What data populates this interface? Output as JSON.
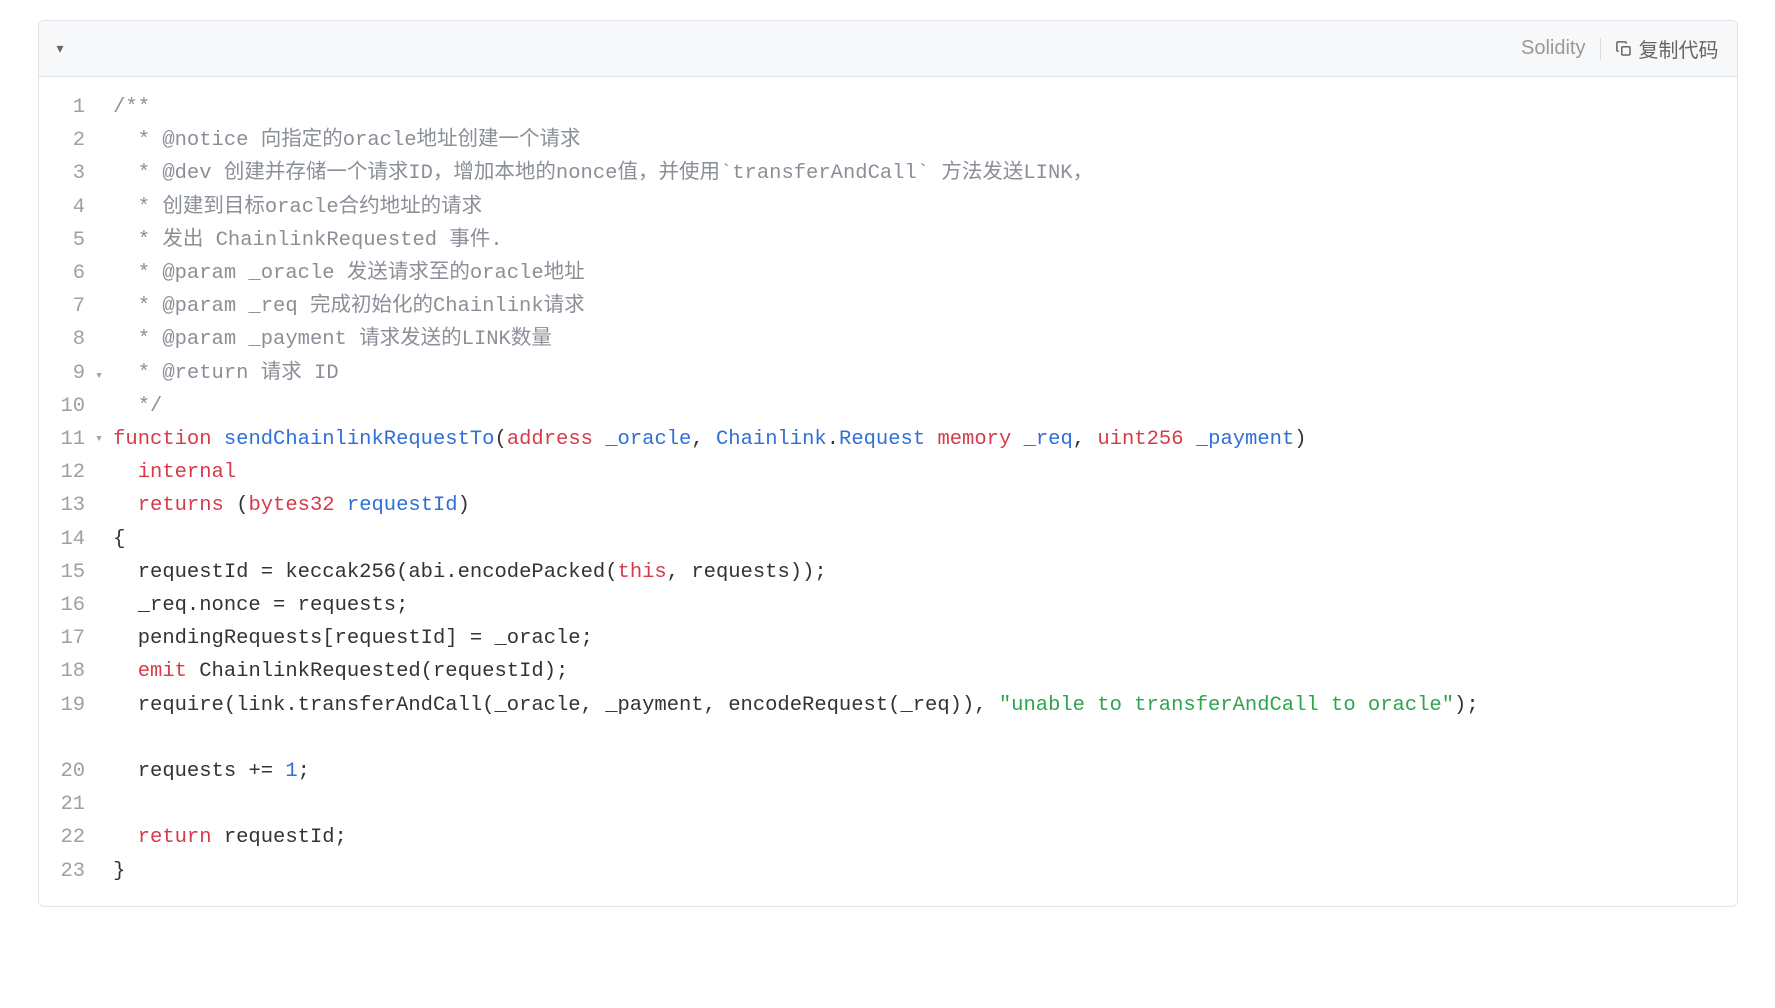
{
  "header": {
    "language": "Solidity",
    "copy_label": "复制代码"
  },
  "code": {
    "lines": [
      {
        "n": 1,
        "fold": "",
        "tokens": [
          {
            "t": "/**",
            "c": "tok-doc"
          }
        ]
      },
      {
        "n": 2,
        "fold": "",
        "tokens": [
          {
            "t": "  * @notice 向指定的oracle地址创建一个请求",
            "c": "tok-doc"
          }
        ]
      },
      {
        "n": 3,
        "fold": "",
        "tokens": [
          {
            "t": "  * @dev 创建并存储一个请求ID，增加本地的nonce值，并使用`transferAndCall` 方法发送LINK，",
            "c": "tok-doc"
          }
        ]
      },
      {
        "n": 4,
        "fold": "",
        "tokens": [
          {
            "t": "  * 创建到目标oracle合约地址的请求",
            "c": "tok-doc"
          }
        ]
      },
      {
        "n": 5,
        "fold": "",
        "tokens": [
          {
            "t": "  * 发出 ChainlinkRequested 事件.",
            "c": "tok-doc"
          }
        ]
      },
      {
        "n": 6,
        "fold": "",
        "tokens": [
          {
            "t": "  * @param _oracle 发送请求至的oracle地址",
            "c": "tok-doc"
          }
        ]
      },
      {
        "n": 7,
        "fold": "",
        "tokens": [
          {
            "t": "  * @param _req 完成初始化的Chainlink请求",
            "c": "tok-doc"
          }
        ]
      },
      {
        "n": 8,
        "fold": "",
        "tokens": [
          {
            "t": "  * @param _payment 请求发送的LINK数量",
            "c": "tok-doc"
          }
        ]
      },
      {
        "n": 9,
        "fold": "",
        "tokens": [
          {
            "t": "  * @return 请求 ID",
            "c": "tok-doc"
          }
        ]
      },
      {
        "n": 10,
        "fold": "",
        "tokens": [
          {
            "t": "  */",
            "c": "tok-doc"
          }
        ]
      },
      {
        "n": 11,
        "fold": "",
        "tokens": [
          {
            "t": "function",
            "c": "tok-kw"
          },
          {
            "t": " ",
            "c": ""
          },
          {
            "t": "sendChainlinkRequestTo",
            "c": "tok-fn"
          },
          {
            "t": "(",
            "c": "tok-punc"
          },
          {
            "t": "address",
            "c": "tok-type"
          },
          {
            "t": " ",
            "c": ""
          },
          {
            "t": "_oracle",
            "c": "tok-ident"
          },
          {
            "t": ", ",
            "c": "tok-punc"
          },
          {
            "t": "Chainlink",
            "c": "tok-ident"
          },
          {
            "t": ".",
            "c": "tok-punc"
          },
          {
            "t": "Request",
            "c": "tok-ident"
          },
          {
            "t": " ",
            "c": ""
          },
          {
            "t": "memory",
            "c": "tok-kw"
          },
          {
            "t": " ",
            "c": ""
          },
          {
            "t": "_req",
            "c": "tok-ident"
          },
          {
            "t": ", ",
            "c": "tok-punc"
          },
          {
            "t": "uint256",
            "c": "tok-type"
          },
          {
            "t": " ",
            "c": ""
          },
          {
            "t": "_payment",
            "c": "tok-ident"
          },
          {
            "t": ")",
            "c": "tok-punc"
          }
        ]
      },
      {
        "n": 12,
        "fold": "",
        "tokens": [
          {
            "t": "  ",
            "c": ""
          },
          {
            "t": "internal",
            "c": "tok-kw"
          }
        ]
      },
      {
        "n": 13,
        "fold": "",
        "tokens": [
          {
            "t": "  ",
            "c": ""
          },
          {
            "t": "returns",
            "c": "tok-kw"
          },
          {
            "t": " (",
            "c": "tok-punc"
          },
          {
            "t": "bytes32",
            "c": "tok-type"
          },
          {
            "t": " ",
            "c": ""
          },
          {
            "t": "requestId",
            "c": "tok-ident"
          },
          {
            "t": ")",
            "c": "tok-punc"
          }
        ]
      },
      {
        "n": 14,
        "fold": "▾",
        "tokens": [
          {
            "t": "{",
            "c": "tok-punc"
          }
        ]
      },
      {
        "n": 15,
        "fold": "",
        "tokens": [
          {
            "t": "  requestId ",
            "c": ""
          },
          {
            "t": "=",
            "c": "tok-op"
          },
          {
            "t": " keccak256(abi.encodePacked(",
            "c": ""
          },
          {
            "t": "this",
            "c": "tok-this"
          },
          {
            "t": ", requests));",
            "c": ""
          }
        ]
      },
      {
        "n": 16,
        "fold": "",
        "tokens": [
          {
            "t": "  _req.nonce ",
            "c": ""
          },
          {
            "t": "=",
            "c": "tok-op"
          },
          {
            "t": " requests;",
            "c": ""
          }
        ]
      },
      {
        "n": 17,
        "fold": "▾",
        "tokens": [
          {
            "t": "  pendingRequests[requestId] ",
            "c": ""
          },
          {
            "t": "=",
            "c": "tok-op"
          },
          {
            "t": " _oracle;",
            "c": ""
          }
        ]
      },
      {
        "n": 18,
        "fold": "",
        "tokens": [
          {
            "t": "  ",
            "c": ""
          },
          {
            "t": "emit",
            "c": "tok-kw"
          },
          {
            "t": " ChainlinkRequested(requestId);",
            "c": ""
          }
        ]
      },
      {
        "n": 19,
        "fold": "",
        "wrap": true,
        "tokens": [
          {
            "t": "  require(link.transferAndCall(_oracle, _payment, encodeRequest(_req)), ",
            "c": ""
          },
          {
            "t": "\"unable to transferAndCall to oracle\"",
            "c": "tok-str"
          },
          {
            "t": ");",
            "c": ""
          }
        ]
      },
      {
        "n": 20,
        "fold": "",
        "tokens": [
          {
            "t": "  requests ",
            "c": ""
          },
          {
            "t": "+=",
            "c": "tok-op"
          },
          {
            "t": " ",
            "c": ""
          },
          {
            "t": "1",
            "c": "tok-num"
          },
          {
            "t": ";",
            "c": ""
          }
        ]
      },
      {
        "n": 21,
        "fold": "",
        "tokens": [
          {
            "t": "",
            "c": ""
          }
        ]
      },
      {
        "n": 22,
        "fold": "",
        "tokens": [
          {
            "t": "  ",
            "c": ""
          },
          {
            "t": "return",
            "c": "tok-kw"
          },
          {
            "t": " requestId;",
            "c": ""
          }
        ]
      },
      {
        "n": 23,
        "fold": "",
        "tokens": [
          {
            "t": "}",
            "c": "tok-punc"
          }
        ]
      }
    ]
  }
}
